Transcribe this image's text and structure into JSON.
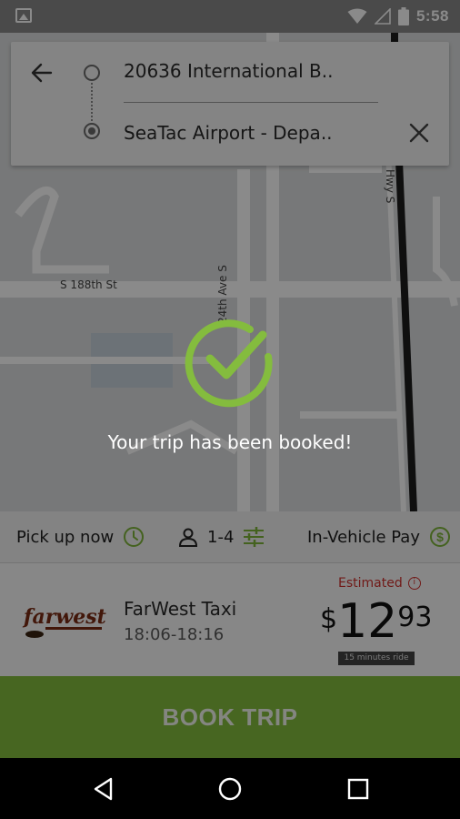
{
  "status_bar": {
    "time": "5:58",
    "icons": [
      "gallery-icon",
      "wifi-icon",
      "signal-icon",
      "battery-icon"
    ]
  },
  "map": {
    "streets": [
      "S 188th St",
      "24th Ave S",
      "Hwy S"
    ]
  },
  "route": {
    "origin": "20636 International B..",
    "destination": "SeaTac Airport - Depa..",
    "icons": [
      "back-arrow-icon",
      "close-icon"
    ]
  },
  "options": {
    "pickup_label": "Pick up now",
    "riders_label": "1-4",
    "payment_label": "In-Vehicle Pay"
  },
  "provider": {
    "name": "FarWest Taxi",
    "time_window": "18:06-18:16",
    "estimated_label": "Estimated",
    "price_currency": "$",
    "price_dollars": "12",
    "price_cents": "93",
    "duration_label": "15 minutes ride",
    "logo_text": "farwest"
  },
  "book_button_label": "BOOK TRIP",
  "confirmation": {
    "message": "Your trip has been booked!"
  },
  "colors": {
    "accent_green": "#84bc3e",
    "estimated_red": "#d0312d"
  }
}
